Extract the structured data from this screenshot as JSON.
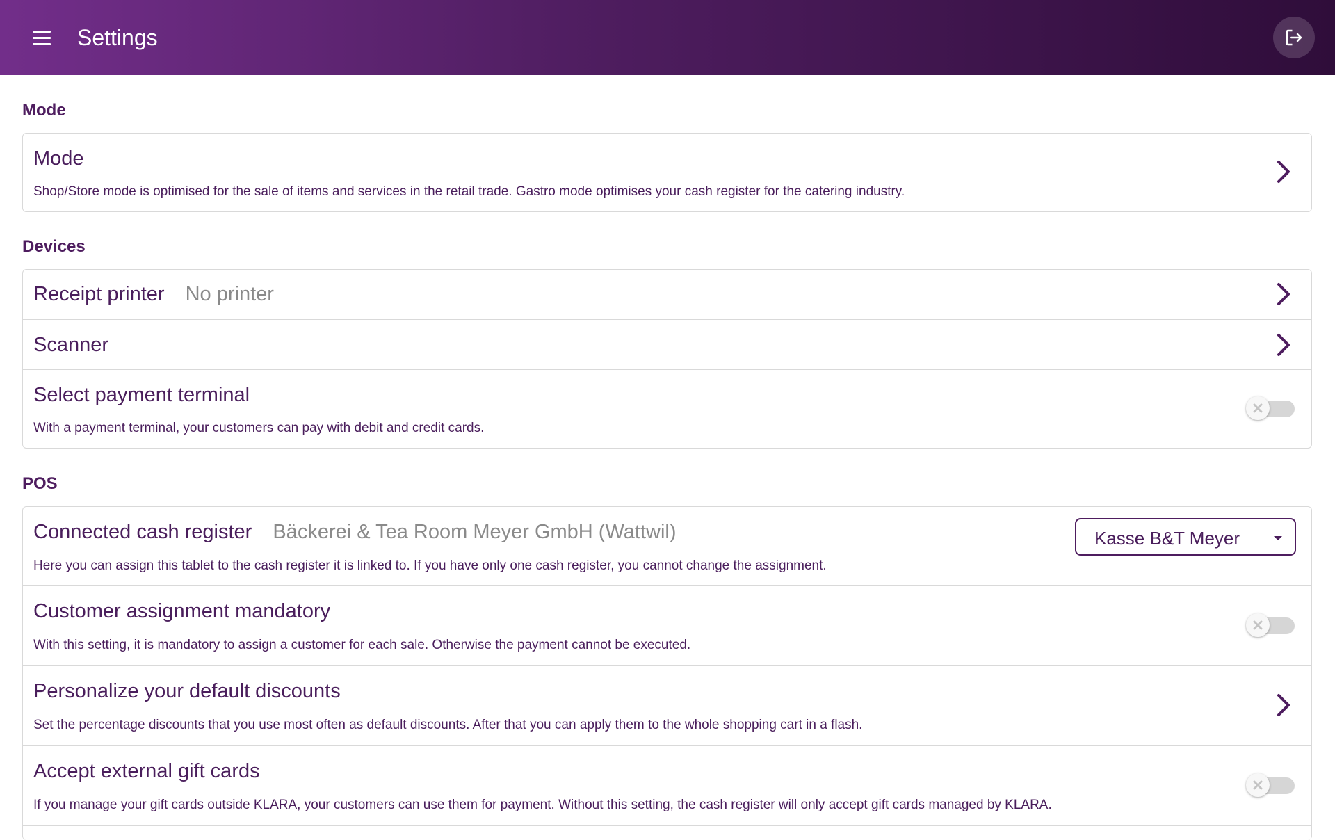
{
  "header": {
    "title": "Settings",
    "menu_icon": "hamburger-menu-icon",
    "logout_icon": "logout-icon"
  },
  "sections": {
    "mode": {
      "title": "Mode",
      "mode_row": {
        "title": "Mode",
        "description": "Shop/Store mode is optimised for the sale of items and services in the retail trade. Gastro mode optimises your cash register for the catering industry."
      }
    },
    "devices": {
      "title": "Devices",
      "receipt_printer": {
        "title": "Receipt printer",
        "value": "No printer"
      },
      "scanner": {
        "title": "Scanner"
      },
      "payment_terminal": {
        "title": "Select payment terminal",
        "description": "With a payment terminal, your customers can pay with debit and credit cards.",
        "enabled": false
      }
    },
    "pos": {
      "title": "POS",
      "connected_register": {
        "title": "Connected cash register",
        "value": "Bäckerei & Tea Room Meyer GmbH (Wattwil)",
        "description": "Here you can assign this tablet to the cash register it is linked to. If you have only one cash register, you cannot change the assignment.",
        "selected": "Kasse B&T Meyer"
      },
      "customer_assignment": {
        "title": "Customer assignment mandatory",
        "description": "With this setting, it is mandatory to assign a customer for each sale. Otherwise the payment cannot be executed.",
        "enabled": false
      },
      "default_discounts": {
        "title": "Personalize your default discounts",
        "description": "Set the percentage discounts that you use most often as default discounts. After that you can apply them to the whole shopping cart in a flash."
      },
      "external_gift_cards": {
        "title": "Accept external gift cards",
        "description": "If you manage your gift cards outside KLARA, your customers can use them for payment. Without this setting, the cash register will only accept gift cards managed by KLARA.",
        "enabled": false
      }
    }
  },
  "colors": {
    "primary": "#4e1d5f",
    "header_start": "#722e8a",
    "header_end": "#2f0d3a",
    "secondary_text": "#8a8a8a"
  }
}
